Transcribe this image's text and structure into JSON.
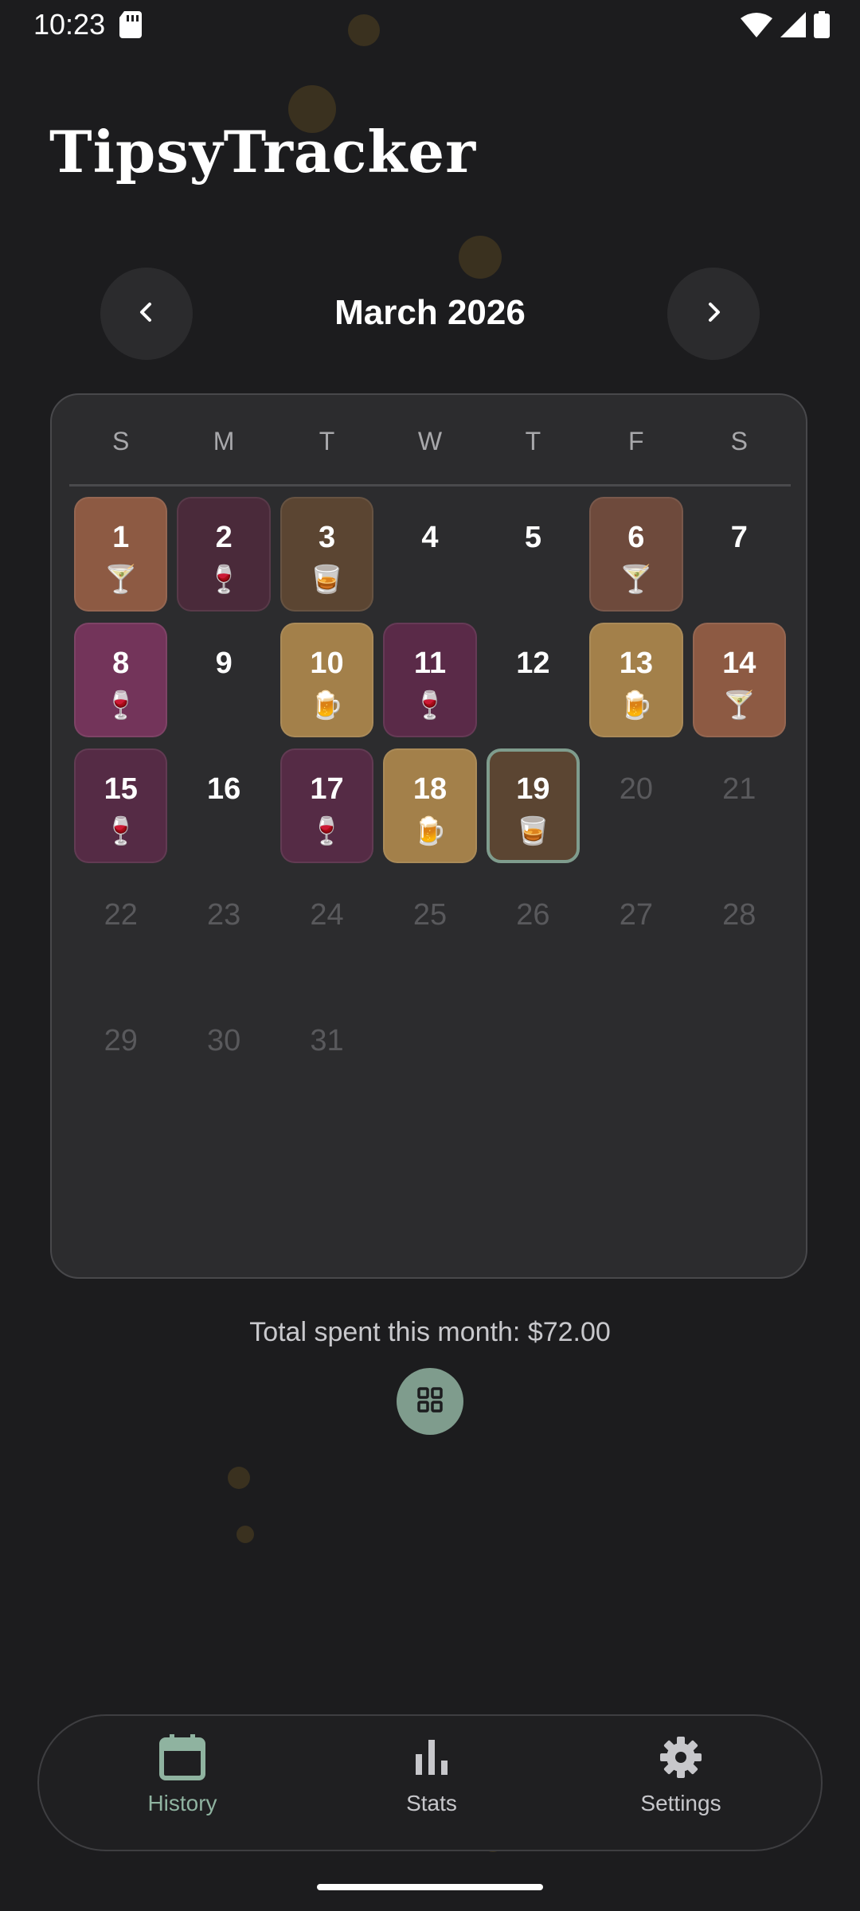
{
  "status_bar": {
    "time": "10:23"
  },
  "app": {
    "title": "TipsyTracker"
  },
  "calendar": {
    "month_label": "March 2026",
    "weekdays": [
      "S",
      "M",
      "T",
      "W",
      "T",
      "F",
      "S"
    ],
    "days": [
      {
        "day": "1",
        "drink": "martini",
        "emoji": "🍸",
        "color": "#8d5a43"
      },
      {
        "day": "2",
        "drink": "wine",
        "emoji": "🍷",
        "color": "#4a2a3a"
      },
      {
        "day": "3",
        "drink": "whiskey",
        "emoji": "🥃",
        "color": "#5b4532"
      },
      {
        "day": "4"
      },
      {
        "day": "5"
      },
      {
        "day": "6",
        "drink": "martini",
        "emoji": "🍸",
        "color": "#6e4a3c"
      },
      {
        "day": "7"
      },
      {
        "day": "8",
        "drink": "wine",
        "emoji": "🍷",
        "color": "#73345a"
      },
      {
        "day": "9"
      },
      {
        "day": "10",
        "drink": "beer",
        "emoji": "🍺",
        "color": "#a3804a"
      },
      {
        "day": "11",
        "drink": "wine",
        "emoji": "🍷",
        "color": "#5a2a48"
      },
      {
        "day": "12"
      },
      {
        "day": "13",
        "drink": "beer",
        "emoji": "🍺",
        "color": "#a3804a"
      },
      {
        "day": "14",
        "drink": "martini",
        "emoji": "🍸",
        "color": "#8d5a43"
      },
      {
        "day": "15",
        "drink": "wine",
        "emoji": "🍷",
        "color": "#552b45"
      },
      {
        "day": "16"
      },
      {
        "day": "17",
        "drink": "wine",
        "emoji": "🍷",
        "color": "#552b45"
      },
      {
        "day": "18",
        "drink": "beer",
        "emoji": "🍺",
        "color": "#a3804a"
      },
      {
        "day": "19",
        "drink": "whiskey",
        "emoji": "🥃",
        "color": "#5b4532",
        "today": true
      },
      {
        "day": "20",
        "future": true
      },
      {
        "day": "21",
        "future": true
      },
      {
        "day": "22",
        "future": true
      },
      {
        "day": "23",
        "future": true
      },
      {
        "day": "24",
        "future": true
      },
      {
        "day": "25",
        "future": true
      },
      {
        "day": "26",
        "future": true
      },
      {
        "day": "27",
        "future": true
      },
      {
        "day": "28",
        "future": true
      },
      {
        "day": "29",
        "future": true
      },
      {
        "day": "30",
        "future": true
      },
      {
        "day": "31",
        "future": true
      }
    ]
  },
  "summary": {
    "total_text": "Total spent this month: $72.00"
  },
  "bottom_nav": {
    "items": [
      {
        "label": "History",
        "icon": "calendar-icon",
        "active": true
      },
      {
        "label": "Stats",
        "icon": "bar-chart-icon",
        "active": false
      },
      {
        "label": "Settings",
        "icon": "gear-icon",
        "active": false
      }
    ]
  },
  "colors": {
    "accent": "#8fb3a0",
    "fab": "#7f9c8d",
    "background": "#1c1c1e"
  }
}
